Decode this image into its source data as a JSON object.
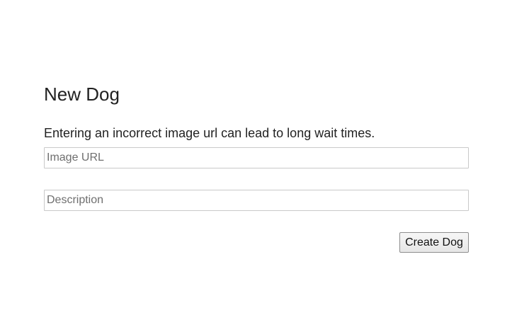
{
  "form": {
    "title": "New Dog",
    "notice": "Entering an incorrect image url can lead to long wait times.",
    "image_url": {
      "value": "",
      "placeholder": "Image URL"
    },
    "description": {
      "value": "",
      "placeholder": "Description"
    },
    "submit_label": "Create Dog"
  }
}
